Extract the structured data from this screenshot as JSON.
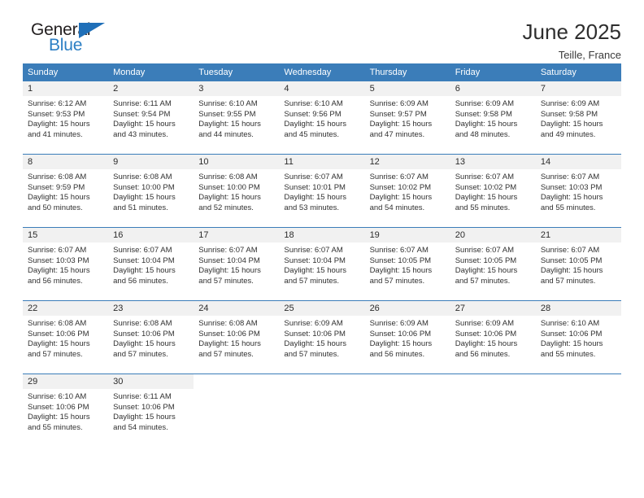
{
  "brand": {
    "name_top": "General",
    "name_bottom": "Blue",
    "triangle_icon": "triangle-logo-icon",
    "colors": {
      "blue": "#2c7fc4",
      "dark": "#231f20",
      "triangle": "#1f6fb8"
    }
  },
  "header": {
    "title": "June 2025",
    "location": "Teille, France"
  },
  "theme": {
    "header_blue": "#3b7db9",
    "daynum_band": "#f1f1f1",
    "text": "#303030"
  },
  "calendar": {
    "weekday_headers": [
      "Sunday",
      "Monday",
      "Tuesday",
      "Wednesday",
      "Thursday",
      "Friday",
      "Saturday"
    ],
    "labels": {
      "sunrise_prefix": "Sunrise:",
      "sunset_prefix": "Sunset:",
      "daylight_prefix": "Daylight:"
    },
    "weeks": [
      [
        {
          "day": "1",
          "sunrise": "Sunrise: 6:12 AM",
          "sunset": "Sunset: 9:53 PM",
          "daylight_line1": "Daylight: 15 hours",
          "daylight_line2": "and 41 minutes."
        },
        {
          "day": "2",
          "sunrise": "Sunrise: 6:11 AM",
          "sunset": "Sunset: 9:54 PM",
          "daylight_line1": "Daylight: 15 hours",
          "daylight_line2": "and 43 minutes."
        },
        {
          "day": "3",
          "sunrise": "Sunrise: 6:10 AM",
          "sunset": "Sunset: 9:55 PM",
          "daylight_line1": "Daylight: 15 hours",
          "daylight_line2": "and 44 minutes."
        },
        {
          "day": "4",
          "sunrise": "Sunrise: 6:10 AM",
          "sunset": "Sunset: 9:56 PM",
          "daylight_line1": "Daylight: 15 hours",
          "daylight_line2": "and 45 minutes."
        },
        {
          "day": "5",
          "sunrise": "Sunrise: 6:09 AM",
          "sunset": "Sunset: 9:57 PM",
          "daylight_line1": "Daylight: 15 hours",
          "daylight_line2": "and 47 minutes."
        },
        {
          "day": "6",
          "sunrise": "Sunrise: 6:09 AM",
          "sunset": "Sunset: 9:58 PM",
          "daylight_line1": "Daylight: 15 hours",
          "daylight_line2": "and 48 minutes."
        },
        {
          "day": "7",
          "sunrise": "Sunrise: 6:09 AM",
          "sunset": "Sunset: 9:58 PM",
          "daylight_line1": "Daylight: 15 hours",
          "daylight_line2": "and 49 minutes."
        }
      ],
      [
        {
          "day": "8",
          "sunrise": "Sunrise: 6:08 AM",
          "sunset": "Sunset: 9:59 PM",
          "daylight_line1": "Daylight: 15 hours",
          "daylight_line2": "and 50 minutes."
        },
        {
          "day": "9",
          "sunrise": "Sunrise: 6:08 AM",
          "sunset": "Sunset: 10:00 PM",
          "daylight_line1": "Daylight: 15 hours",
          "daylight_line2": "and 51 minutes."
        },
        {
          "day": "10",
          "sunrise": "Sunrise: 6:08 AM",
          "sunset": "Sunset: 10:00 PM",
          "daylight_line1": "Daylight: 15 hours",
          "daylight_line2": "and 52 minutes."
        },
        {
          "day": "11",
          "sunrise": "Sunrise: 6:07 AM",
          "sunset": "Sunset: 10:01 PM",
          "daylight_line1": "Daylight: 15 hours",
          "daylight_line2": "and 53 minutes."
        },
        {
          "day": "12",
          "sunrise": "Sunrise: 6:07 AM",
          "sunset": "Sunset: 10:02 PM",
          "daylight_line1": "Daylight: 15 hours",
          "daylight_line2": "and 54 minutes."
        },
        {
          "day": "13",
          "sunrise": "Sunrise: 6:07 AM",
          "sunset": "Sunset: 10:02 PM",
          "daylight_line1": "Daylight: 15 hours",
          "daylight_line2": "and 55 minutes."
        },
        {
          "day": "14",
          "sunrise": "Sunrise: 6:07 AM",
          "sunset": "Sunset: 10:03 PM",
          "daylight_line1": "Daylight: 15 hours",
          "daylight_line2": "and 55 minutes."
        }
      ],
      [
        {
          "day": "15",
          "sunrise": "Sunrise: 6:07 AM",
          "sunset": "Sunset: 10:03 PM",
          "daylight_line1": "Daylight: 15 hours",
          "daylight_line2": "and 56 minutes."
        },
        {
          "day": "16",
          "sunrise": "Sunrise: 6:07 AM",
          "sunset": "Sunset: 10:04 PM",
          "daylight_line1": "Daylight: 15 hours",
          "daylight_line2": "and 56 minutes."
        },
        {
          "day": "17",
          "sunrise": "Sunrise: 6:07 AM",
          "sunset": "Sunset: 10:04 PM",
          "daylight_line1": "Daylight: 15 hours",
          "daylight_line2": "and 57 minutes."
        },
        {
          "day": "18",
          "sunrise": "Sunrise: 6:07 AM",
          "sunset": "Sunset: 10:04 PM",
          "daylight_line1": "Daylight: 15 hours",
          "daylight_line2": "and 57 minutes."
        },
        {
          "day": "19",
          "sunrise": "Sunrise: 6:07 AM",
          "sunset": "Sunset: 10:05 PM",
          "daylight_line1": "Daylight: 15 hours",
          "daylight_line2": "and 57 minutes."
        },
        {
          "day": "20",
          "sunrise": "Sunrise: 6:07 AM",
          "sunset": "Sunset: 10:05 PM",
          "daylight_line1": "Daylight: 15 hours",
          "daylight_line2": "and 57 minutes."
        },
        {
          "day": "21",
          "sunrise": "Sunrise: 6:07 AM",
          "sunset": "Sunset: 10:05 PM",
          "daylight_line1": "Daylight: 15 hours",
          "daylight_line2": "and 57 minutes."
        }
      ],
      [
        {
          "day": "22",
          "sunrise": "Sunrise: 6:08 AM",
          "sunset": "Sunset: 10:06 PM",
          "daylight_line1": "Daylight: 15 hours",
          "daylight_line2": "and 57 minutes."
        },
        {
          "day": "23",
          "sunrise": "Sunrise: 6:08 AM",
          "sunset": "Sunset: 10:06 PM",
          "daylight_line1": "Daylight: 15 hours",
          "daylight_line2": "and 57 minutes."
        },
        {
          "day": "24",
          "sunrise": "Sunrise: 6:08 AM",
          "sunset": "Sunset: 10:06 PM",
          "daylight_line1": "Daylight: 15 hours",
          "daylight_line2": "and 57 minutes."
        },
        {
          "day": "25",
          "sunrise": "Sunrise: 6:09 AM",
          "sunset": "Sunset: 10:06 PM",
          "daylight_line1": "Daylight: 15 hours",
          "daylight_line2": "and 57 minutes."
        },
        {
          "day": "26",
          "sunrise": "Sunrise: 6:09 AM",
          "sunset": "Sunset: 10:06 PM",
          "daylight_line1": "Daylight: 15 hours",
          "daylight_line2": "and 56 minutes."
        },
        {
          "day": "27",
          "sunrise": "Sunrise: 6:09 AM",
          "sunset": "Sunset: 10:06 PM",
          "daylight_line1": "Daylight: 15 hours",
          "daylight_line2": "and 56 minutes."
        },
        {
          "day": "28",
          "sunrise": "Sunrise: 6:10 AM",
          "sunset": "Sunset: 10:06 PM",
          "daylight_line1": "Daylight: 15 hours",
          "daylight_line2": "and 55 minutes."
        }
      ],
      [
        {
          "day": "29",
          "sunrise": "Sunrise: 6:10 AM",
          "sunset": "Sunset: 10:06 PM",
          "daylight_line1": "Daylight: 15 hours",
          "daylight_line2": "and 55 minutes."
        },
        {
          "day": "30",
          "sunrise": "Sunrise: 6:11 AM",
          "sunset": "Sunset: 10:06 PM",
          "daylight_line1": "Daylight: 15 hours",
          "daylight_line2": "and 54 minutes."
        },
        {
          "day": "",
          "sunrise": "",
          "sunset": "",
          "daylight_line1": "",
          "daylight_line2": ""
        },
        {
          "day": "",
          "sunrise": "",
          "sunset": "",
          "daylight_line1": "",
          "daylight_line2": ""
        },
        {
          "day": "",
          "sunrise": "",
          "sunset": "",
          "daylight_line1": "",
          "daylight_line2": ""
        },
        {
          "day": "",
          "sunrise": "",
          "sunset": "",
          "daylight_line1": "",
          "daylight_line2": ""
        },
        {
          "day": "",
          "sunrise": "",
          "sunset": "",
          "daylight_line1": "",
          "daylight_line2": ""
        }
      ]
    ]
  }
}
